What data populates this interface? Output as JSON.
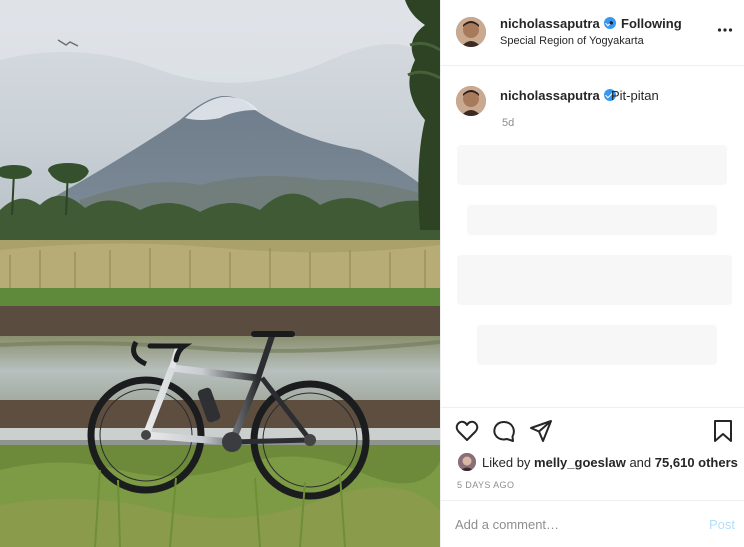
{
  "post": {
    "photo_alt": "",
    "header": {
      "username": "nicholassaputra",
      "separator": "•",
      "follow_status": "Following",
      "location": "Special Region of Yogyakarta",
      "more_icon": "more-horizontal-icon"
    },
    "caption": {
      "username": "nicholassaputra",
      "text": "Pit-pitan",
      "time": "5d"
    },
    "actions": {
      "like_icon": "heart-icon",
      "comment_icon": "comment-icon",
      "share_icon": "share-icon",
      "save_icon": "bookmark-icon"
    },
    "likes": {
      "prefix": "Liked by",
      "user": "melly_goeslaw",
      "and": "and",
      "others": "75,610 others"
    },
    "date": "5 DAYS AGO",
    "comment": {
      "placeholder": "Add a comment…",
      "post_label": "Post"
    }
  },
  "colors": {
    "verified": "#3897f0",
    "muted": "#8e8e8e",
    "post_button_disabled": "#b2dffc",
    "border": "#efefef"
  }
}
